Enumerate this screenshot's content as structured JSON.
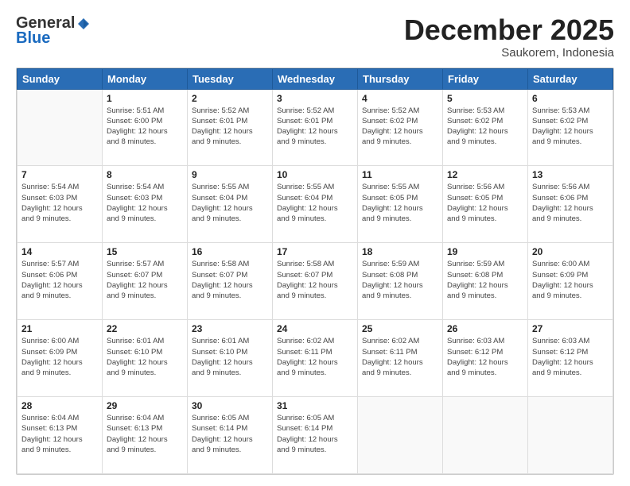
{
  "header": {
    "logo_general": "General",
    "logo_blue": "Blue",
    "month": "December 2025",
    "location": "Saukorem, Indonesia"
  },
  "days_of_week": [
    "Sunday",
    "Monday",
    "Tuesday",
    "Wednesday",
    "Thursday",
    "Friday",
    "Saturday"
  ],
  "weeks": [
    [
      {
        "day": "",
        "info": ""
      },
      {
        "day": "1",
        "info": "Sunrise: 5:51 AM\nSunset: 6:00 PM\nDaylight: 12 hours\nand 8 minutes."
      },
      {
        "day": "2",
        "info": "Sunrise: 5:52 AM\nSunset: 6:01 PM\nDaylight: 12 hours\nand 9 minutes."
      },
      {
        "day": "3",
        "info": "Sunrise: 5:52 AM\nSunset: 6:01 PM\nDaylight: 12 hours\nand 9 minutes."
      },
      {
        "day": "4",
        "info": "Sunrise: 5:52 AM\nSunset: 6:02 PM\nDaylight: 12 hours\nand 9 minutes."
      },
      {
        "day": "5",
        "info": "Sunrise: 5:53 AM\nSunset: 6:02 PM\nDaylight: 12 hours\nand 9 minutes."
      },
      {
        "day": "6",
        "info": "Sunrise: 5:53 AM\nSunset: 6:02 PM\nDaylight: 12 hours\nand 9 minutes."
      }
    ],
    [
      {
        "day": "7",
        "info": "Sunrise: 5:54 AM\nSunset: 6:03 PM\nDaylight: 12 hours\nand 9 minutes."
      },
      {
        "day": "8",
        "info": "Sunrise: 5:54 AM\nSunset: 6:03 PM\nDaylight: 12 hours\nand 9 minutes."
      },
      {
        "day": "9",
        "info": "Sunrise: 5:55 AM\nSunset: 6:04 PM\nDaylight: 12 hours\nand 9 minutes."
      },
      {
        "day": "10",
        "info": "Sunrise: 5:55 AM\nSunset: 6:04 PM\nDaylight: 12 hours\nand 9 minutes."
      },
      {
        "day": "11",
        "info": "Sunrise: 5:55 AM\nSunset: 6:05 PM\nDaylight: 12 hours\nand 9 minutes."
      },
      {
        "day": "12",
        "info": "Sunrise: 5:56 AM\nSunset: 6:05 PM\nDaylight: 12 hours\nand 9 minutes."
      },
      {
        "day": "13",
        "info": "Sunrise: 5:56 AM\nSunset: 6:06 PM\nDaylight: 12 hours\nand 9 minutes."
      }
    ],
    [
      {
        "day": "14",
        "info": "Sunrise: 5:57 AM\nSunset: 6:06 PM\nDaylight: 12 hours\nand 9 minutes."
      },
      {
        "day": "15",
        "info": "Sunrise: 5:57 AM\nSunset: 6:07 PM\nDaylight: 12 hours\nand 9 minutes."
      },
      {
        "day": "16",
        "info": "Sunrise: 5:58 AM\nSunset: 6:07 PM\nDaylight: 12 hours\nand 9 minutes."
      },
      {
        "day": "17",
        "info": "Sunrise: 5:58 AM\nSunset: 6:07 PM\nDaylight: 12 hours\nand 9 minutes."
      },
      {
        "day": "18",
        "info": "Sunrise: 5:59 AM\nSunset: 6:08 PM\nDaylight: 12 hours\nand 9 minutes."
      },
      {
        "day": "19",
        "info": "Sunrise: 5:59 AM\nSunset: 6:08 PM\nDaylight: 12 hours\nand 9 minutes."
      },
      {
        "day": "20",
        "info": "Sunrise: 6:00 AM\nSunset: 6:09 PM\nDaylight: 12 hours\nand 9 minutes."
      }
    ],
    [
      {
        "day": "21",
        "info": "Sunrise: 6:00 AM\nSunset: 6:09 PM\nDaylight: 12 hours\nand 9 minutes."
      },
      {
        "day": "22",
        "info": "Sunrise: 6:01 AM\nSunset: 6:10 PM\nDaylight: 12 hours\nand 9 minutes."
      },
      {
        "day": "23",
        "info": "Sunrise: 6:01 AM\nSunset: 6:10 PM\nDaylight: 12 hours\nand 9 minutes."
      },
      {
        "day": "24",
        "info": "Sunrise: 6:02 AM\nSunset: 6:11 PM\nDaylight: 12 hours\nand 9 minutes."
      },
      {
        "day": "25",
        "info": "Sunrise: 6:02 AM\nSunset: 6:11 PM\nDaylight: 12 hours\nand 9 minutes."
      },
      {
        "day": "26",
        "info": "Sunrise: 6:03 AM\nSunset: 6:12 PM\nDaylight: 12 hours\nand 9 minutes."
      },
      {
        "day": "27",
        "info": "Sunrise: 6:03 AM\nSunset: 6:12 PM\nDaylight: 12 hours\nand 9 minutes."
      }
    ],
    [
      {
        "day": "28",
        "info": "Sunrise: 6:04 AM\nSunset: 6:13 PM\nDaylight: 12 hours\nand 9 minutes."
      },
      {
        "day": "29",
        "info": "Sunrise: 6:04 AM\nSunset: 6:13 PM\nDaylight: 12 hours\nand 9 minutes."
      },
      {
        "day": "30",
        "info": "Sunrise: 6:05 AM\nSunset: 6:14 PM\nDaylight: 12 hours\nand 9 minutes."
      },
      {
        "day": "31",
        "info": "Sunrise: 6:05 AM\nSunset: 6:14 PM\nDaylight: 12 hours\nand 9 minutes."
      },
      {
        "day": "",
        "info": ""
      },
      {
        "day": "",
        "info": ""
      },
      {
        "day": "",
        "info": ""
      }
    ]
  ]
}
